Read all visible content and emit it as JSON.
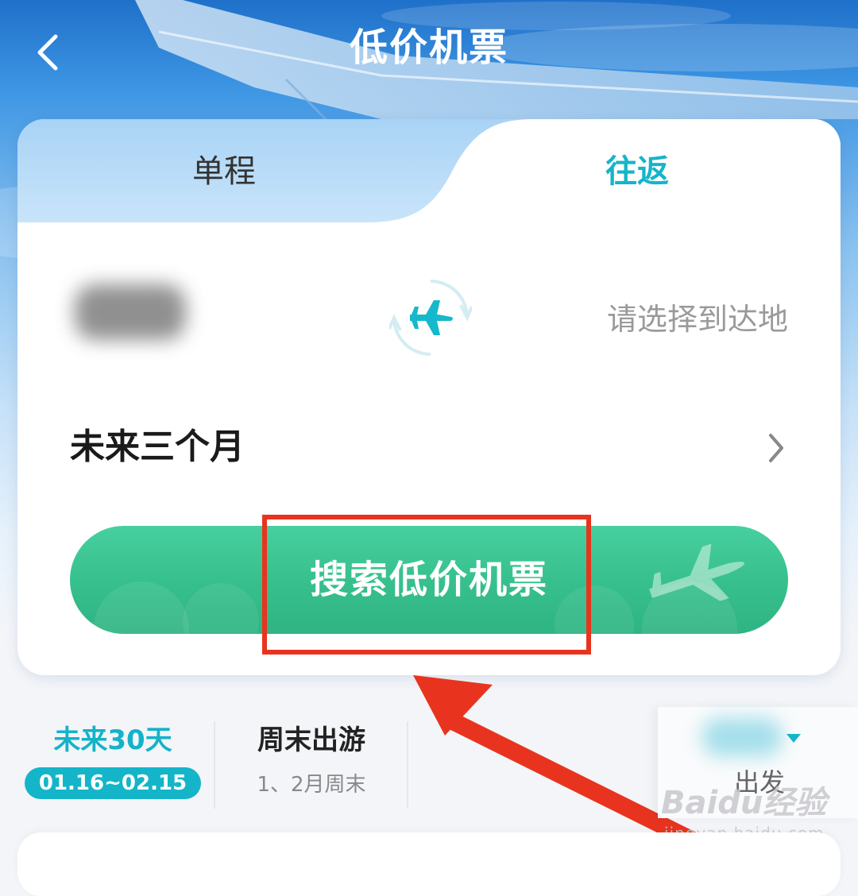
{
  "header": {
    "title": "低价机票"
  },
  "tabs": {
    "one_way": "单程",
    "round_trip": "往返",
    "active": "round_trip"
  },
  "route": {
    "destination_placeholder": "请选择到达地"
  },
  "date": {
    "label": "未来三个月"
  },
  "search": {
    "button_label": "搜索低价机票"
  },
  "filters": {
    "next30": {
      "title": "未来30天",
      "range": "01.16~02.15"
    },
    "weekend": {
      "title": "周末出游",
      "subtitle": "1、2月周末"
    },
    "depart": {
      "label": "出发"
    }
  },
  "watermark": {
    "brand": "Baidu经验",
    "url": "jingyan.baidu.com"
  },
  "colors": {
    "accent": "#14b5c9",
    "search_green": "#36bf8c",
    "annotation_red": "#e8341f"
  }
}
